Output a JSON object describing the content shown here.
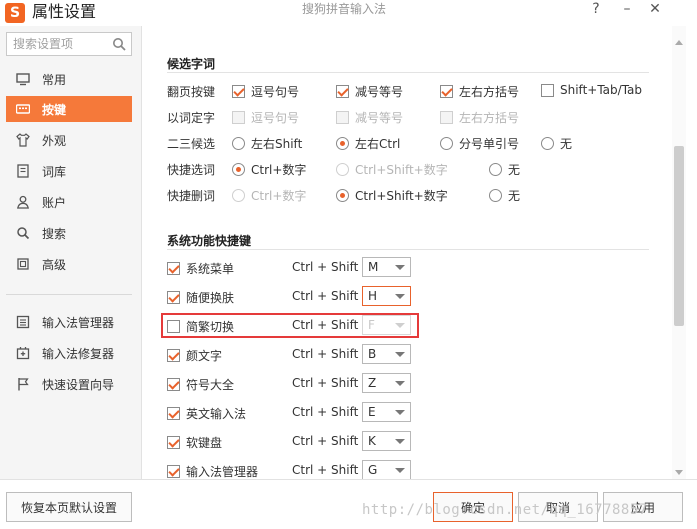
{
  "titlebar": {
    "logo": "S",
    "title": "属性设置",
    "subtitle": "搜狗拼音输入法",
    "help": "?",
    "minimize": "–",
    "close": "✕"
  },
  "sidebar": {
    "search_placeholder": "搜索设置项",
    "items": [
      {
        "label": "常用",
        "icon": "monitor-icon"
      },
      {
        "label": "按键",
        "icon": "keyboard-icon"
      },
      {
        "label": "外观",
        "icon": "shirt-icon"
      },
      {
        "label": "词库",
        "icon": "book-icon"
      },
      {
        "label": "账户",
        "icon": "user-icon"
      },
      {
        "label": "搜索",
        "icon": "search-icon"
      },
      {
        "label": "高级",
        "icon": "square-icon"
      }
    ],
    "tools": [
      {
        "label": "输入法管理器",
        "icon": "manager-icon"
      },
      {
        "label": "输入法修复器",
        "icon": "repair-icon"
      },
      {
        "label": "快速设置向导",
        "icon": "flag-icon"
      }
    ]
  },
  "candidates": {
    "section_title": "候选字词",
    "row_paging": {
      "label": "翻页按键",
      "options": [
        {
          "label": "逗号句号",
          "checked": true
        },
        {
          "label": "减号等号",
          "checked": true
        },
        {
          "label": "左右方括号",
          "checked": true
        },
        {
          "label": "Shift+Tab/Tab",
          "checked": false
        }
      ]
    },
    "row_word": {
      "label": "以词定字",
      "options": [
        {
          "label": "逗号句号"
        },
        {
          "label": "减号等号"
        },
        {
          "label": "左右方括号"
        }
      ]
    },
    "row_second": {
      "label": "二三候选",
      "options": [
        {
          "label": "左右Shift",
          "selected": false
        },
        {
          "label": "左右Ctrl",
          "selected": true
        },
        {
          "label": "分号单引号",
          "selected": false
        },
        {
          "label": "无",
          "selected": false
        }
      ]
    },
    "row_quick_select": {
      "label": "快捷选词",
      "options": [
        {
          "label": "Ctrl+数字",
          "selected": true
        },
        {
          "label": "Ctrl+Shift+数字",
          "selected": false
        },
        {
          "label": "无",
          "selected": false
        }
      ]
    },
    "row_quick_delete": {
      "label": "快捷删词",
      "options": [
        {
          "label": "Ctrl+数字",
          "selected": false
        },
        {
          "label": "Ctrl+Shift+数字",
          "selected": true
        },
        {
          "label": "无",
          "selected": false
        }
      ]
    }
  },
  "hotkeys": {
    "section_title": "系统功能快捷键",
    "combo": "Ctrl + Shift +",
    "items": [
      {
        "label": "系统菜单",
        "checked": true,
        "key": "M"
      },
      {
        "label": "随便换肤",
        "checked": true,
        "key": "H"
      },
      {
        "label": "简繁切换",
        "checked": false,
        "key": "F"
      },
      {
        "label": "颜文字",
        "checked": true,
        "key": "B"
      },
      {
        "label": "符号大全",
        "checked": true,
        "key": "Z"
      },
      {
        "label": "英文输入法",
        "checked": true,
        "key": "E"
      },
      {
        "label": "软键盘",
        "checked": true,
        "key": "K"
      },
      {
        "label": "输入法管理器",
        "checked": true,
        "key": "G"
      }
    ]
  },
  "footer": {
    "restore_label": "恢复本页默认设置",
    "ok_label": "确定",
    "cancel_label": "取消",
    "apply_label": "应用"
  },
  "watermark": "http://blog.csdn.net/qq_16778857",
  "colors": {
    "accent": "#f5793a",
    "check": "#e8622c",
    "highlight": "#e53a3a"
  }
}
